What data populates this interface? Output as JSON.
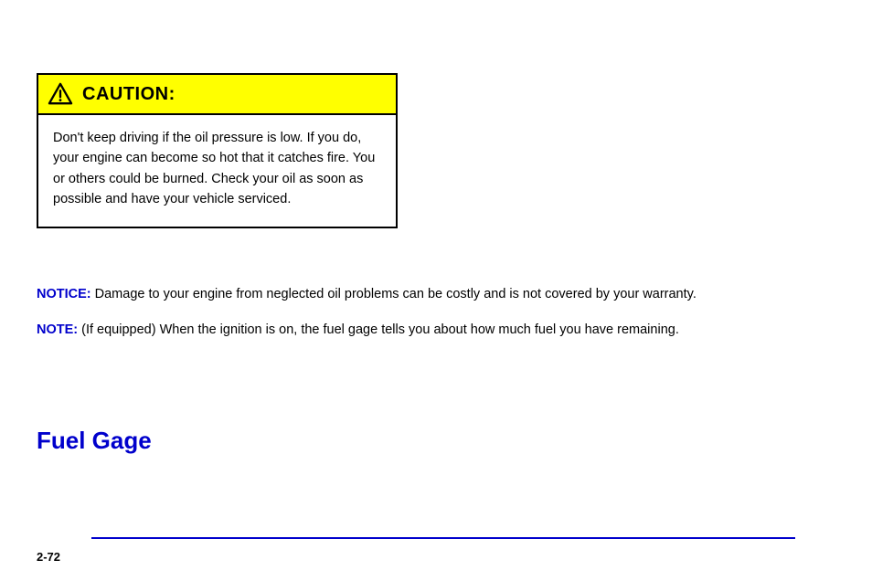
{
  "caution": {
    "title": "CAUTION:",
    "body": "Don't keep driving if the oil pressure is low. If you do, your engine can become so hot that it catches fire. You or others could be burned. Check your oil as soon as possible and have your vehicle serviced."
  },
  "notice": {
    "label": "NOTICE:",
    "text": "Damage to your engine from neglected oil problems can be costly and is not covered by your warranty."
  },
  "note": {
    "label": "NOTE:",
    "text": "(If equipped) When the ignition is on, the fuel gage tells you about how much fuel you have remaining."
  },
  "heading": "Fuel Gage",
  "page_number": "2-72"
}
